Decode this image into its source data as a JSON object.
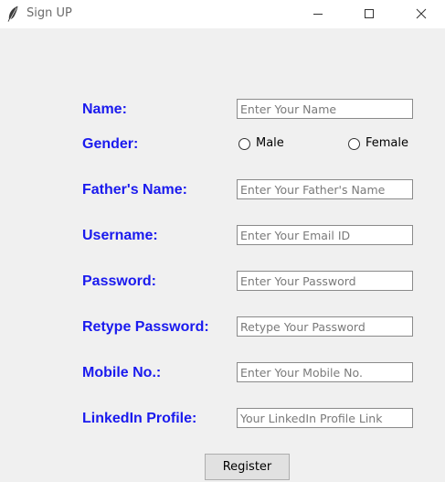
{
  "window": {
    "title": "Sign UP",
    "controls": {
      "minimize": "minimize",
      "maximize": "maximize",
      "close": "close"
    }
  },
  "form": {
    "name": {
      "label": "Name:",
      "placeholder": "Enter Your Name",
      "value": ""
    },
    "gender": {
      "label": "Gender:",
      "options": [
        "Male",
        "Female"
      ],
      "selected": null
    },
    "father_name": {
      "label": "Father's Name:",
      "placeholder": "Enter Your Father's Name",
      "value": ""
    },
    "username": {
      "label": "Username:",
      "placeholder": "Enter Your Email ID",
      "value": ""
    },
    "password": {
      "label": "Password:",
      "placeholder": "Enter Your Password",
      "value": ""
    },
    "retype_password": {
      "label": "Retype Password:",
      "placeholder": "Retype Your Password",
      "value": ""
    },
    "mobile": {
      "label": "Mobile No.:",
      "placeholder": "Enter Your Mobile No.",
      "value": ""
    },
    "linkedin": {
      "label": "LinkedIn Profile:",
      "placeholder": "Your LinkedIn Profile Link",
      "value": ""
    },
    "register_label": "Register"
  },
  "colors": {
    "label_text": "#1a1aee",
    "window_background": "#f0f0f0",
    "titlebar_background": "#ffffff",
    "button_face": "#e1e1e1"
  },
  "icons": {
    "app": "feather-icon",
    "minimize": "minimize-icon",
    "maximize": "maximize-icon",
    "close": "close-icon"
  }
}
